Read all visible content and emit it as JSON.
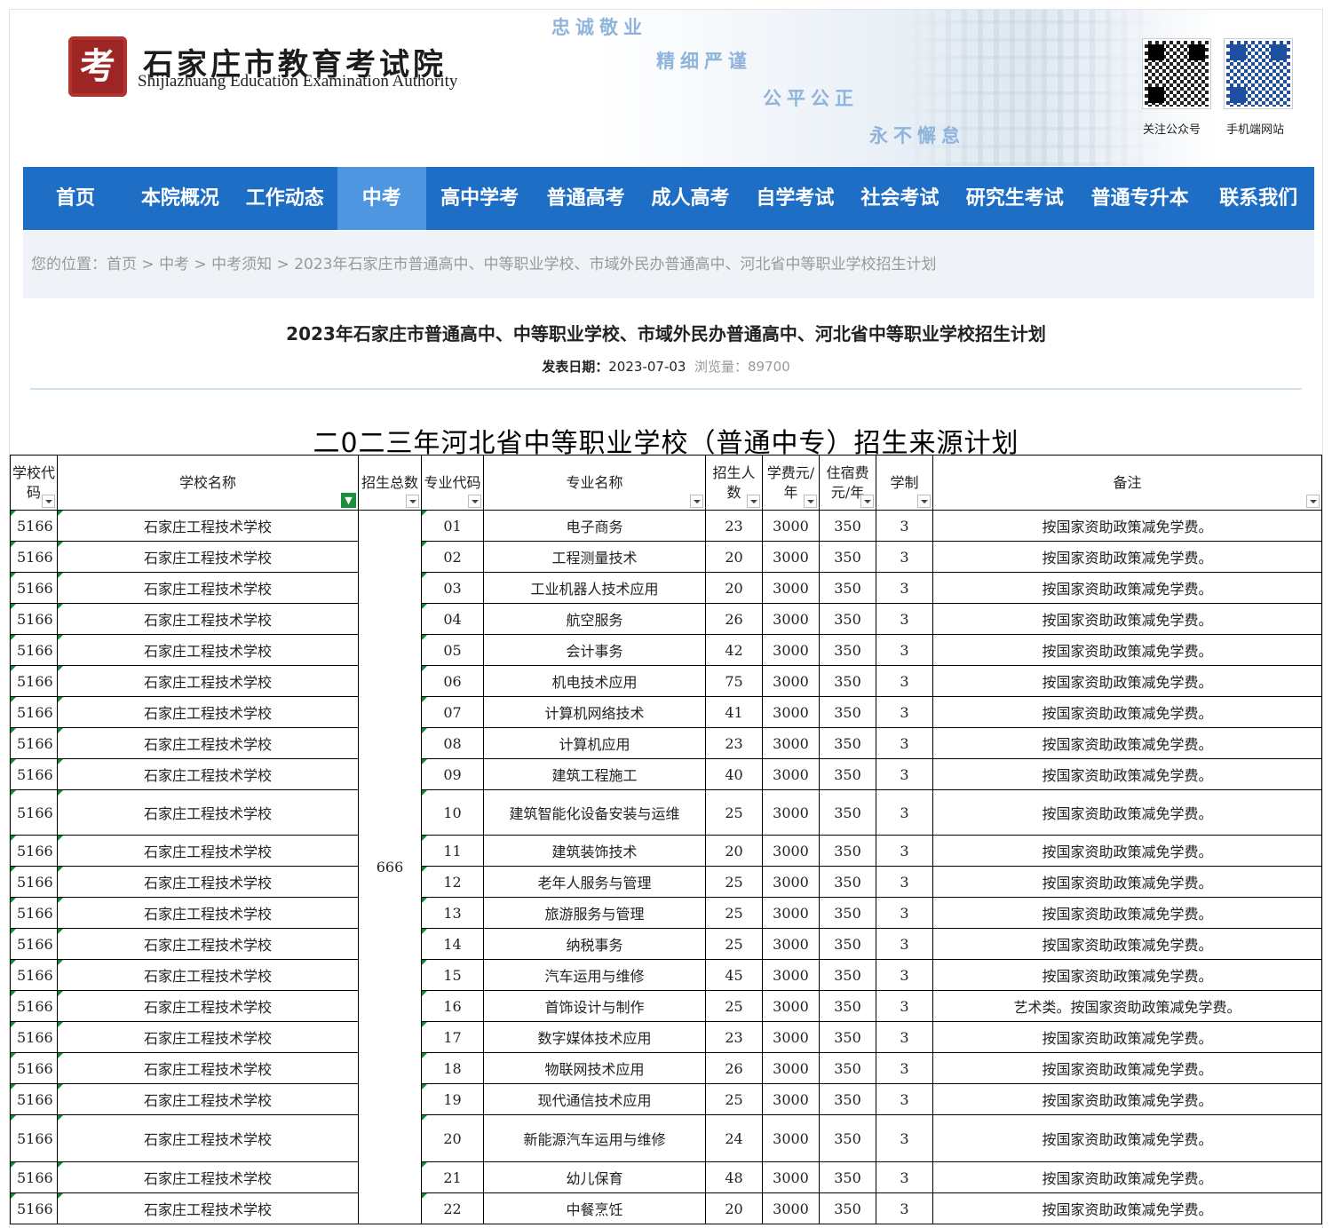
{
  "header": {
    "seal_char": "考",
    "title_cn": "石家庄市教育考试院",
    "title_en": "Shijiazhuang Education Examination Authority",
    "slogans": [
      "忠诚敬业",
      "精细严谨",
      "公平公正",
      "永不懈怠"
    ],
    "qr_labels": [
      "关注公众号",
      "手机端网站"
    ]
  },
  "nav": {
    "items": [
      "首页",
      "本院概况",
      "工作动态",
      "中考",
      "高中学考",
      "普通高考",
      "成人高考",
      "自学考试",
      "社会考试",
      "研究生考试",
      "普通专升本",
      "联系我们"
    ],
    "active_index": 3
  },
  "breadcrumb": {
    "prefix": "您的位置：",
    "links": [
      "首页",
      "中考",
      "中考须知"
    ],
    "current": "2023年石家庄市普通高中、中等职业学校、市域外民办普通高中、河北省中等职业学校招生计划",
    "sep": " > "
  },
  "article": {
    "title": "2023年石家庄市普通高中、中等职业学校、市域外民办普通高中、河北省中等职业学校招生计划",
    "date_label": "发表日期：",
    "date": "2023-07-03",
    "views_label": "浏览量：",
    "views": "89700"
  },
  "sheet": {
    "title": "二0二三年河北省中等职业学校（普通中专）招生来源计划",
    "headers": [
      "学校代码",
      "学校名称",
      "招生总数",
      "专业代码",
      "专业名称",
      "招生人数",
      "学费元/年",
      "住宿费元/年",
      "学制",
      "备注"
    ],
    "total": "666",
    "rows": [
      [
        "5166",
        "石家庄工程技术学校",
        "01",
        "电子商务",
        "23",
        "3000",
        "350",
        "3",
        "按国家资助政策减免学费。"
      ],
      [
        "5166",
        "石家庄工程技术学校",
        "02",
        "工程测量技术",
        "20",
        "3000",
        "350",
        "3",
        "按国家资助政策减免学费。"
      ],
      [
        "5166",
        "石家庄工程技术学校",
        "03",
        "工业机器人技术应用",
        "20",
        "3000",
        "350",
        "3",
        "按国家资助政策减免学费。"
      ],
      [
        "5166",
        "石家庄工程技术学校",
        "04",
        "航空服务",
        "26",
        "3000",
        "350",
        "3",
        "按国家资助政策减免学费。"
      ],
      [
        "5166",
        "石家庄工程技术学校",
        "05",
        "会计事务",
        "42",
        "3000",
        "350",
        "3",
        "按国家资助政策减免学费。"
      ],
      [
        "5166",
        "石家庄工程技术学校",
        "06",
        "机电技术应用",
        "75",
        "3000",
        "350",
        "3",
        "按国家资助政策减免学费。"
      ],
      [
        "5166",
        "石家庄工程技术学校",
        "07",
        "计算机网络技术",
        "41",
        "3000",
        "350",
        "3",
        "按国家资助政策减免学费。"
      ],
      [
        "5166",
        "石家庄工程技术学校",
        "08",
        "计算机应用",
        "23",
        "3000",
        "350",
        "3",
        "按国家资助政策减免学费。"
      ],
      [
        "5166",
        "石家庄工程技术学校",
        "09",
        "建筑工程施工",
        "40",
        "3000",
        "350",
        "3",
        "按国家资助政策减免学费。"
      ],
      [
        "5166",
        "石家庄工程技术学校",
        "10",
        "建筑智能化设备安装与运维",
        "25",
        "3000",
        "350",
        "3",
        "按国家资助政策减免学费。"
      ],
      [
        "5166",
        "石家庄工程技术学校",
        "11",
        "建筑装饰技术",
        "20",
        "3000",
        "350",
        "3",
        "按国家资助政策减免学费。"
      ],
      [
        "5166",
        "石家庄工程技术学校",
        "12",
        "老年人服务与管理",
        "25",
        "3000",
        "350",
        "3",
        "按国家资助政策减免学费。"
      ],
      [
        "5166",
        "石家庄工程技术学校",
        "13",
        "旅游服务与管理",
        "25",
        "3000",
        "350",
        "3",
        "按国家资助政策减免学费。"
      ],
      [
        "5166",
        "石家庄工程技术学校",
        "14",
        "纳税事务",
        "25",
        "3000",
        "350",
        "3",
        "按国家资助政策减免学费。"
      ],
      [
        "5166",
        "石家庄工程技术学校",
        "15",
        "汽车运用与维修",
        "45",
        "3000",
        "350",
        "3",
        "按国家资助政策减免学费。"
      ],
      [
        "5166",
        "石家庄工程技术学校",
        "16",
        "首饰设计与制作",
        "25",
        "3000",
        "350",
        "3",
        "艺术类。按国家资助政策减免学费。"
      ],
      [
        "5166",
        "石家庄工程技术学校",
        "17",
        "数字媒体技术应用",
        "23",
        "3000",
        "350",
        "3",
        "按国家资助政策减免学费。"
      ],
      [
        "5166",
        "石家庄工程技术学校",
        "18",
        "物联网技术应用",
        "26",
        "3000",
        "350",
        "3",
        "按国家资助政策减免学费。"
      ],
      [
        "5166",
        "石家庄工程技术学校",
        "19",
        "现代通信技术应用",
        "25",
        "3000",
        "350",
        "3",
        "按国家资助政策减免学费。"
      ],
      [
        "5166",
        "石家庄工程技术学校",
        "20",
        "新能源汽车运用与维修",
        "24",
        "3000",
        "350",
        "3",
        "按国家资助政策减免学费。"
      ],
      [
        "5166",
        "石家庄工程技术学校",
        "21",
        "幼儿保育",
        "48",
        "3000",
        "350",
        "3",
        "按国家资助政策减免学费。"
      ],
      [
        "5166",
        "石家庄工程技术学校",
        "22",
        "中餐烹饪",
        "20",
        "3000",
        "350",
        "3",
        "按国家资助政策减免学费。"
      ]
    ]
  },
  "colors": {
    "nav_bg": "#1f6ec6",
    "nav_active": "#4f96e0",
    "crumb_bg": "#eff2f6",
    "slogan": "#8fb4dc",
    "seal": "#9d2523",
    "filter_green": "#1a8f3c"
  }
}
